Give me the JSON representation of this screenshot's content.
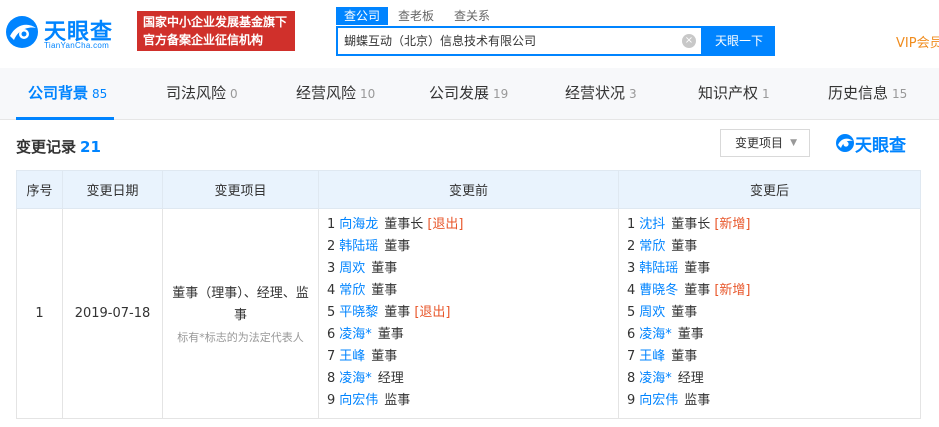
{
  "brand": {
    "name": "天眼查",
    "domain": "TianYanCha.com",
    "badge_line1": "国家中小企业发展基金旗下",
    "badge_line2": "官方备案企业征信机构"
  },
  "search": {
    "tabs": [
      "查公司",
      "查老板",
      "查关系"
    ],
    "query": "蝴蝶互动（北京）信息技术有限公司",
    "clear_glyph": "×",
    "button": "天眼一下",
    "vip": "VIP会员"
  },
  "nav": [
    {
      "label": "公司背景",
      "count": "85"
    },
    {
      "label": "司法风险",
      "count": "0"
    },
    {
      "label": "经营风险",
      "count": "10"
    },
    {
      "label": "公司发展",
      "count": "19"
    },
    {
      "label": "经营状况",
      "count": "3"
    },
    {
      "label": "知识产权",
      "count": "1"
    },
    {
      "label": "历史信息",
      "count": "15"
    }
  ],
  "section": {
    "title": "变更记录",
    "count": "21",
    "filter_label": "变更项目",
    "brand_small": "天眼查"
  },
  "table": {
    "headers": [
      "序号",
      "变更日期",
      "变更项目",
      "变更前",
      "变更后"
    ],
    "row": {
      "seq": "1",
      "date": "2019-07-18",
      "item": "董事（理事）、经理、监事",
      "note": "标有*标志的为法定代表人",
      "before": [
        {
          "idx": "1",
          "name": "向海龙",
          "role": "董事长",
          "tag": "[退出]"
        },
        {
          "idx": "2",
          "name": "韩陆瑶",
          "role": "董事",
          "tag": ""
        },
        {
          "idx": "3",
          "name": "周欢",
          "role": "董事",
          "tag": ""
        },
        {
          "idx": "4",
          "name": "常欣",
          "role": "董事",
          "tag": ""
        },
        {
          "idx": "5",
          "name": "平晓黎",
          "role": "董事",
          "tag": "[退出]"
        },
        {
          "idx": "6",
          "name": "凌海*",
          "role": "董事",
          "tag": ""
        },
        {
          "idx": "7",
          "name": "王峰",
          "role": "董事",
          "tag": ""
        },
        {
          "idx": "8",
          "name": "凌海*",
          "role": "经理",
          "tag": ""
        },
        {
          "idx": "9",
          "name": "向宏伟",
          "role": "监事",
          "tag": ""
        }
      ],
      "after": [
        {
          "idx": "1",
          "name": "沈抖",
          "role": "董事长",
          "tag": "[新增]"
        },
        {
          "idx": "2",
          "name": "常欣",
          "role": "董事",
          "tag": ""
        },
        {
          "idx": "3",
          "name": "韩陆瑶",
          "role": "董事",
          "tag": ""
        },
        {
          "idx": "4",
          "name": "曹晓冬",
          "role": "董事",
          "tag": "[新增]"
        },
        {
          "idx": "5",
          "name": "周欢",
          "role": "董事",
          "tag": ""
        },
        {
          "idx": "6",
          "name": "凌海*",
          "role": "董事",
          "tag": ""
        },
        {
          "idx": "7",
          "name": "王峰",
          "role": "董事",
          "tag": ""
        },
        {
          "idx": "8",
          "name": "凌海*",
          "role": "经理",
          "tag": ""
        },
        {
          "idx": "9",
          "name": "向宏伟",
          "role": "监事",
          "tag": ""
        }
      ]
    }
  },
  "colors": {
    "accent": "#0084ff",
    "badge": "#d0302b",
    "tag": "#e8572b",
    "vip": "#f08c1e"
  }
}
